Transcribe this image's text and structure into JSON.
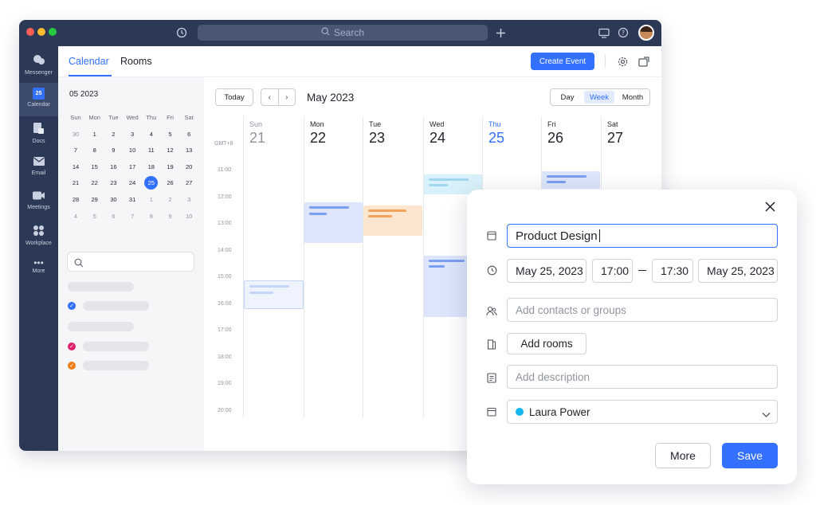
{
  "window": {
    "search_placeholder": "Search"
  },
  "leftnav": {
    "items": [
      {
        "label": "Messenger",
        "icon": "chat-icon"
      },
      {
        "label": "Calendar",
        "icon": "calendar-icon",
        "badge": "25"
      },
      {
        "label": "Docs",
        "icon": "docs-icon"
      },
      {
        "label": "Email",
        "icon": "mail-icon"
      },
      {
        "label": "Meetings",
        "icon": "video-icon"
      },
      {
        "label": "Workplace",
        "icon": "apps-icon"
      },
      {
        "label": "More",
        "icon": "more-icon"
      }
    ]
  },
  "header": {
    "tabs": [
      "Calendar",
      "Rooms"
    ],
    "create_button": "Create Event"
  },
  "mini_calendar": {
    "title": "05 2023",
    "weekdays": [
      "Sun",
      "Mon",
      "Tue",
      "Wed",
      "Thu",
      "Fri",
      "Sat"
    ],
    "weeks": [
      [
        "30",
        "1",
        "2",
        "3",
        "4",
        "5",
        "6"
      ],
      [
        "7",
        "8",
        "9",
        "10",
        "11",
        "12",
        "13"
      ],
      [
        "14",
        "15",
        "16",
        "17",
        "18",
        "19",
        "20"
      ],
      [
        "21",
        "22",
        "23",
        "24",
        "25",
        "26",
        "27"
      ],
      [
        "28",
        "29",
        "30",
        "31",
        "1",
        "2",
        "3"
      ],
      [
        "4",
        "5",
        "6",
        "7",
        "8",
        "9",
        "10"
      ]
    ],
    "selected": "25"
  },
  "toolbar": {
    "today": "Today",
    "prev": "‹",
    "next": "›",
    "month_title": "May 2023",
    "views": [
      "Day",
      "Week",
      "Month"
    ],
    "active_view": "Week"
  },
  "week": {
    "timezone": "GMT+8",
    "days": [
      {
        "name": "Sun",
        "num": "21"
      },
      {
        "name": "Mon",
        "num": "22"
      },
      {
        "name": "Tue",
        "num": "23"
      },
      {
        "name": "Wed",
        "num": "24"
      },
      {
        "name": "Thu",
        "num": "25"
      },
      {
        "name": "Fri",
        "num": "26"
      },
      {
        "name": "Sat",
        "num": "27"
      }
    ],
    "hours": [
      "11:00",
      "12:00",
      "13:00",
      "14:00",
      "15:00",
      "16:00",
      "17:00",
      "18:00",
      "19:00",
      "20:00"
    ]
  },
  "colors": {
    "accent": "#3370ff",
    "nav_bg": "#2b3856",
    "event_blue": "#dce5fb",
    "event_orange": "#fde6cf",
    "event_cyan": "#d8f1fa",
    "calendar_dot": "#14b8ee",
    "check_pink": "#e0226e",
    "check_orange": "#f07f1c"
  },
  "dialog": {
    "title_value": "Product Design",
    "start_date": "May 25, 2023",
    "start_time": "17:00",
    "end_time": "17:30",
    "end_date": "May 25, 2023",
    "contacts_placeholder": "Add contacts or groups",
    "rooms_button": "Add rooms",
    "description_placeholder": "Add description",
    "calendar_owner": "Laura Power",
    "more_button": "More",
    "save_button": "Save"
  }
}
